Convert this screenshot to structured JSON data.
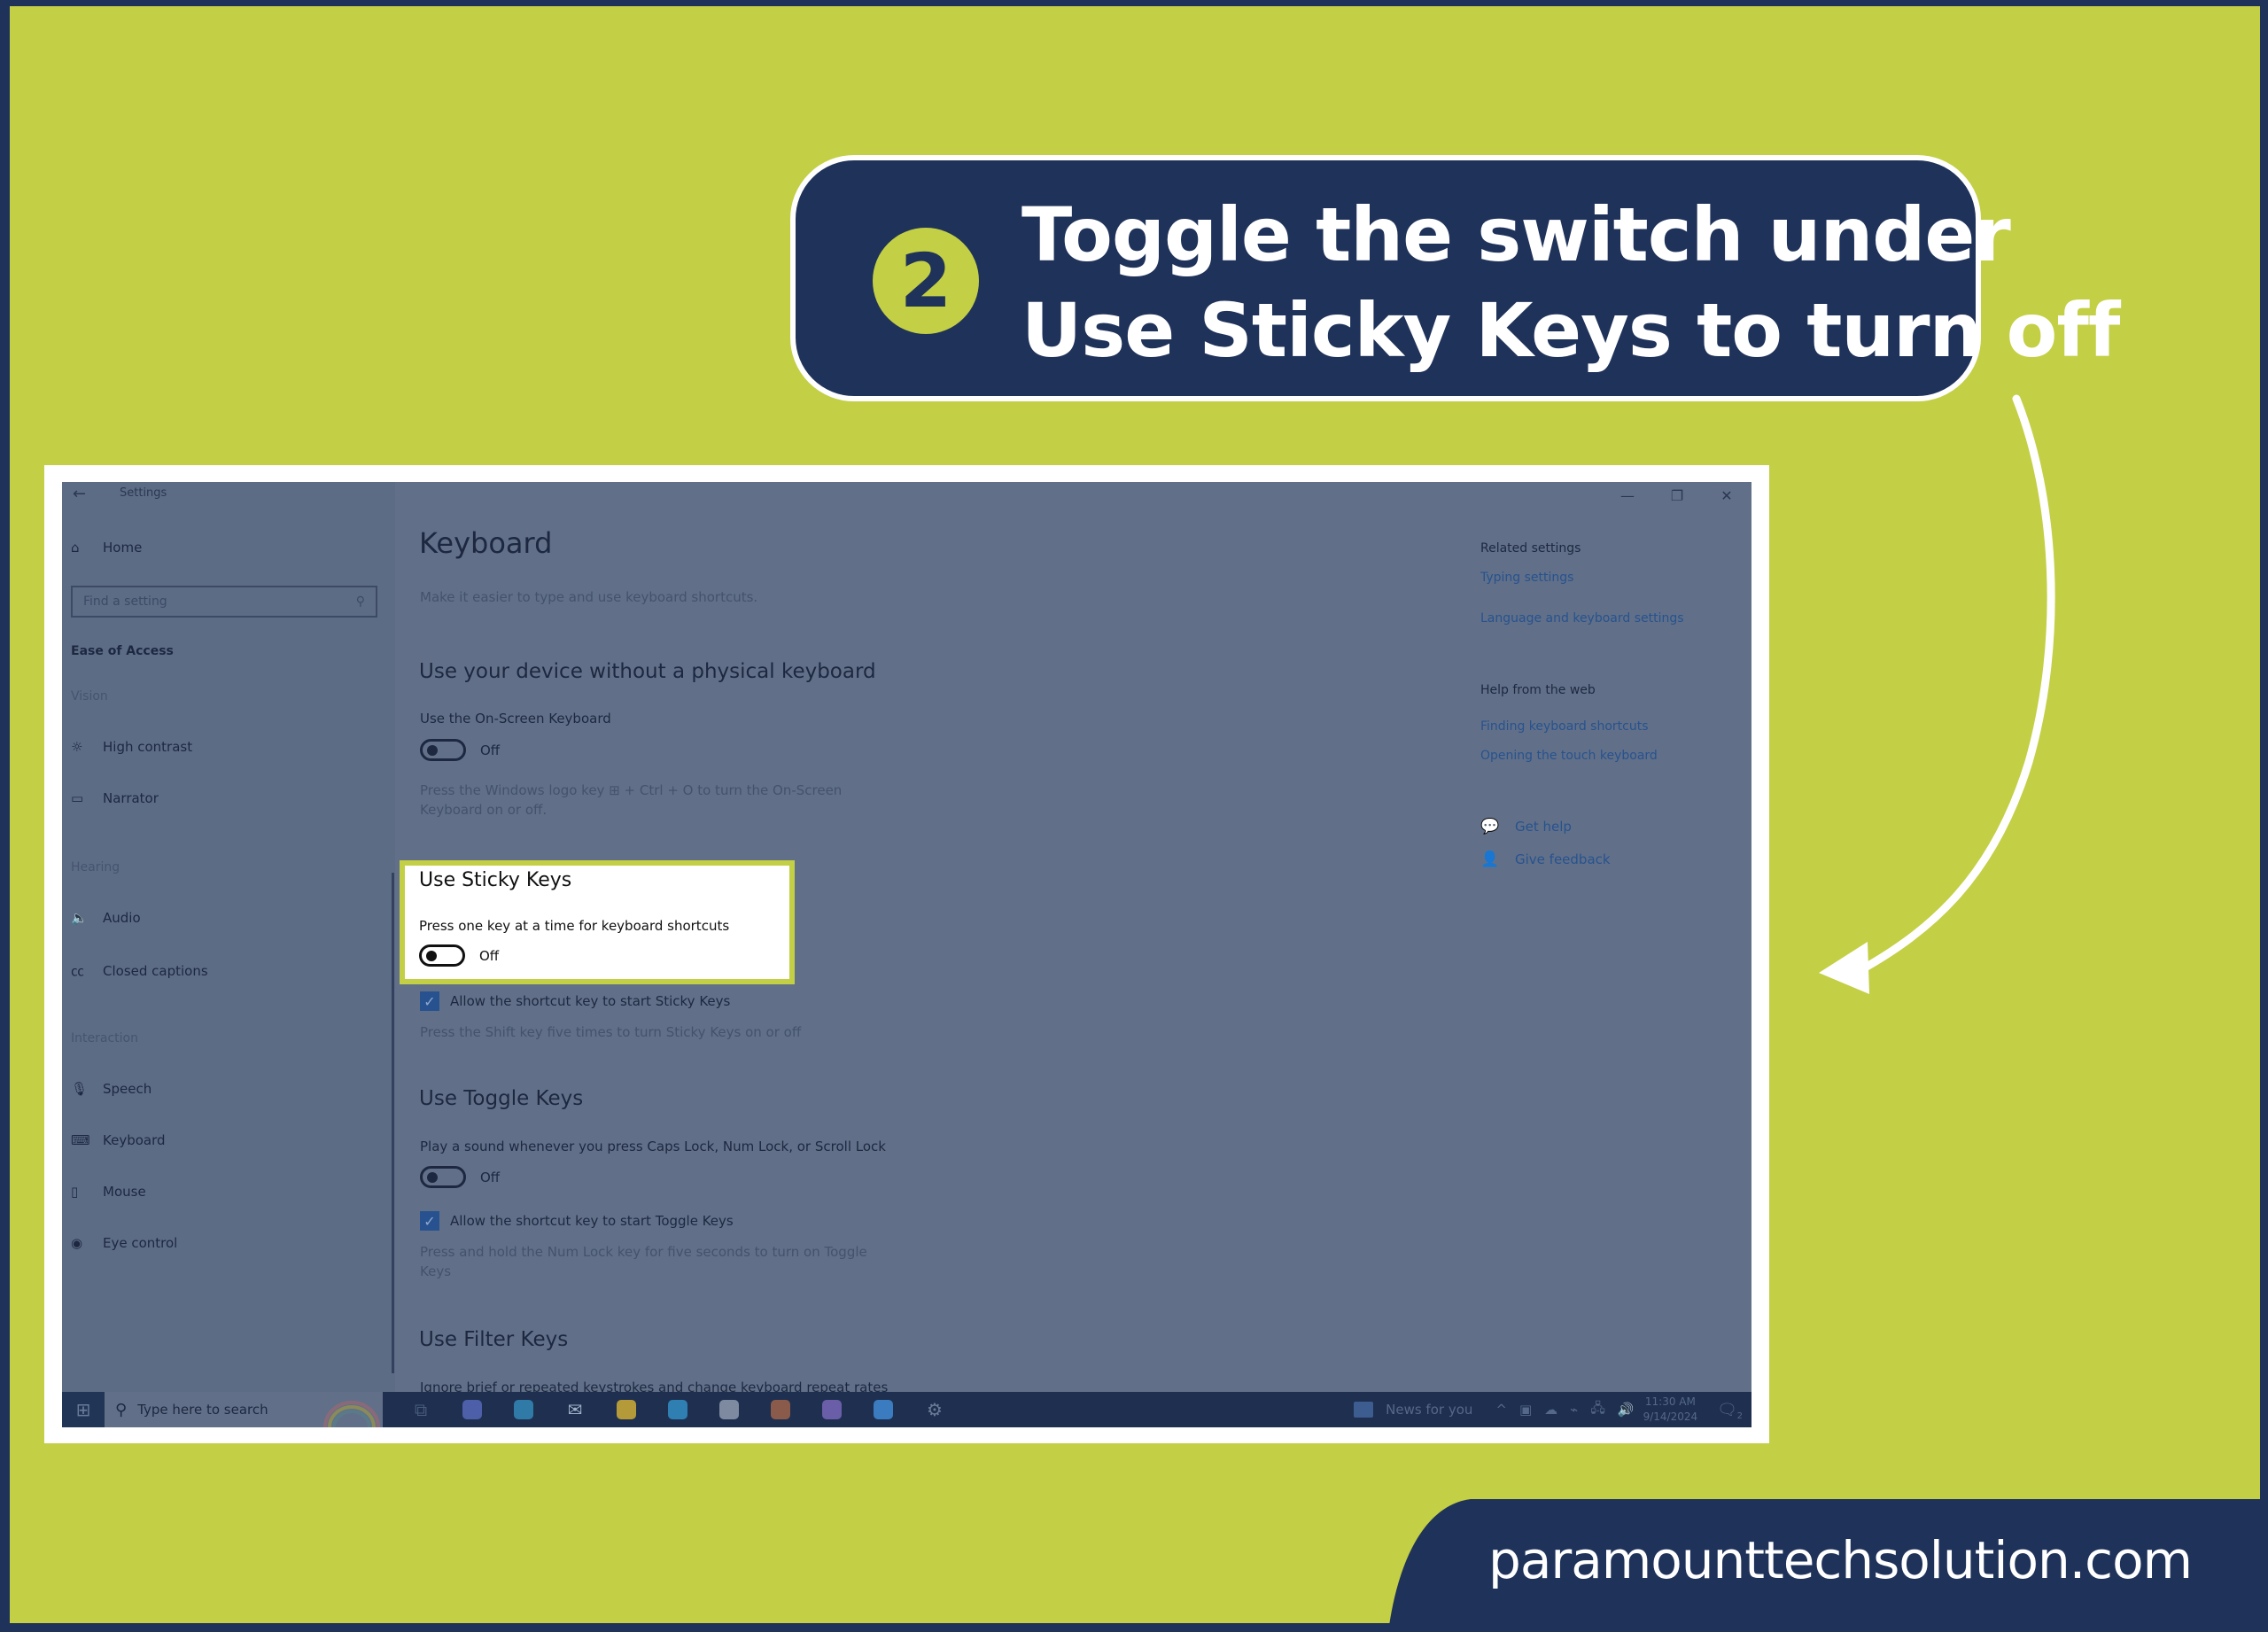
{
  "brand_colors": {
    "background": "#c3cf44",
    "navy": "#1f325a",
    "white": "#ffffff"
  },
  "callout": {
    "step_number": "2",
    "line1": "Toggle the switch under",
    "line2": "Use Sticky Keys to turn off"
  },
  "window": {
    "title": "Settings",
    "back_icon": "←",
    "controls": {
      "minimize": "—",
      "restore": "❐",
      "close": "✕"
    }
  },
  "sidebar": {
    "home": {
      "icon": "⌂",
      "label": "Home"
    },
    "search_placeholder": "Find a setting",
    "search_icon": "⚲",
    "section_title": "Ease of Access",
    "groups": [
      {
        "heading": "Vision",
        "items": [
          {
            "icon": "☼",
            "label": "High contrast"
          },
          {
            "icon": "▭",
            "label": "Narrator"
          }
        ]
      },
      {
        "heading": "Hearing",
        "items": [
          {
            "icon": "🔈",
            "label": "Audio"
          },
          {
            "icon": "㏄",
            "label": "Closed captions"
          }
        ]
      },
      {
        "heading": "Interaction",
        "items": [
          {
            "icon": "🎙",
            "label": "Speech"
          },
          {
            "icon": "⌨",
            "label": "Keyboard"
          },
          {
            "icon": "▯",
            "label": "Mouse"
          },
          {
            "icon": "◉",
            "label": "Eye control"
          }
        ]
      }
    ]
  },
  "main": {
    "title": "Keyboard",
    "subtitle": "Make it easier to type and use keyboard shortcuts.",
    "sections": {
      "osk": {
        "title": "Use your device without a physical keyboard",
        "label": "Use the On-Screen Keyboard",
        "toggle_state": "Off",
        "help": "Press the Windows logo key ⊞ + Ctrl + O to turn the On-Screen Keyboard on or off."
      },
      "sticky": {
        "title": "Use Sticky Keys",
        "label": "Press one key at a time for keyboard shortcuts",
        "toggle_state": "Off",
        "checkbox_label": "Allow the shortcut key to start Sticky Keys",
        "checkbox_checked": true,
        "help": "Press the Shift key five times to turn Sticky Keys on or off"
      },
      "toggle_keys": {
        "title": "Use Toggle Keys",
        "label": "Play a sound whenever you press Caps Lock, Num Lock, or Scroll Lock",
        "toggle_state": "Off",
        "checkbox_label": "Allow the shortcut key to start Toggle Keys",
        "checkbox_checked": true,
        "help": "Press and hold the Num Lock key for five seconds to turn on Toggle Keys"
      },
      "filter_keys": {
        "title": "Use Filter Keys",
        "label": "Ignore brief or repeated keystrokes and change keyboard repeat rates"
      }
    },
    "checkmark": "✓"
  },
  "related": {
    "heading": "Related settings",
    "links": [
      "Typing settings",
      "Language and keyboard settings"
    ],
    "help_heading": "Help from the web",
    "help_links": [
      "Finding keyboard shortcuts",
      "Opening the touch keyboard"
    ],
    "get_help": {
      "icon": "💬",
      "label": "Get help"
    },
    "give_feedback": {
      "icon": "👤",
      "label": "Give feedback"
    }
  },
  "taskbar": {
    "start_icon": "⊞",
    "search_icon": "⚲",
    "search_placeholder": "Type here to search",
    "apps": [
      {
        "name": "task-view",
        "glyph": "⧉",
        "color": "#4a5c7c"
      },
      {
        "name": "copilot",
        "glyph": "",
        "color": "#4d5fa8"
      },
      {
        "name": "edge",
        "glyph": "",
        "color": "#2f7aa6"
      },
      {
        "name": "mail",
        "glyph": "✉",
        "color": "#9fb0c8"
      },
      {
        "name": "file-explorer",
        "glyph": "",
        "color": "#b59a3a"
      },
      {
        "name": "skype",
        "glyph": "",
        "color": "#2f7fb2"
      },
      {
        "name": "app-brain",
        "glyph": "",
        "color": "#7e8aa0"
      },
      {
        "name": "chrome",
        "glyph": "",
        "color": "#8a5a4a"
      },
      {
        "name": "app-drop",
        "glyph": "",
        "color": "#6a5ea8"
      },
      {
        "name": "photos",
        "glyph": "",
        "color": "#3a7cbf"
      },
      {
        "name": "settings",
        "glyph": "⚙",
        "color": "#6a7b98"
      }
    ],
    "news_label": "News for you",
    "tray": [
      "^",
      "▣",
      "☁",
      "⌁",
      "🖧",
      "🔊"
    ],
    "time": "11:30 AM",
    "date": "9/14/2024",
    "notification_icon": "🗨",
    "notification_count": "2"
  },
  "footer": {
    "website": "paramounttechsolution.com"
  }
}
